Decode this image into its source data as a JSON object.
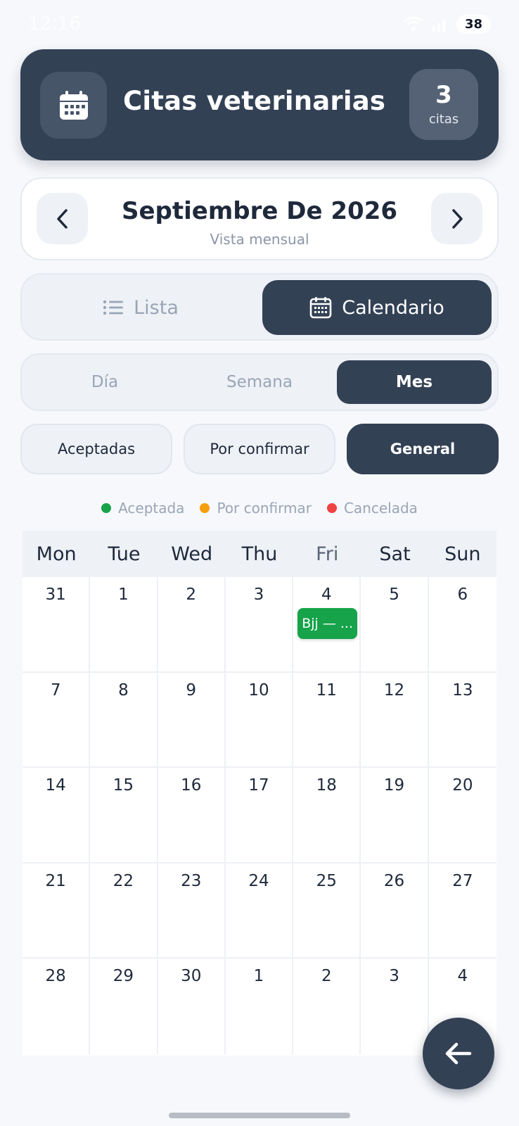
{
  "status_bar": {
    "time": "12:16",
    "battery": "38"
  },
  "header": {
    "title": "Citas veterinarias",
    "count": "3",
    "count_label": "citas",
    "icon": "calendar-icon"
  },
  "month_nav": {
    "title": "Septiembre De 2026",
    "subtitle": "Vista mensual"
  },
  "view_toggle": {
    "list_label": "Lista",
    "calendar_label": "Calendario",
    "selected": "Calendario"
  },
  "period_toggle": {
    "day": "Día",
    "week": "Semana",
    "month": "Mes",
    "selected": "Mes"
  },
  "filters": {
    "accepted": "Aceptadas",
    "pending": "Por confirmar",
    "general": "General",
    "selected": "General"
  },
  "legend": [
    {
      "label": "Aceptada",
      "color": "#16a34a"
    },
    {
      "label": "Por confirmar",
      "color": "#f59e0b"
    },
    {
      "label": "Cancelada",
      "color": "#ef4444"
    }
  ],
  "calendar": {
    "weekdays": [
      "Mon",
      "Tue",
      "Wed",
      "Thu",
      "Fri",
      "Sat",
      "Sun"
    ],
    "weeks": [
      [
        "31",
        "1",
        "2",
        "3",
        "4",
        "5",
        "6"
      ],
      [
        "7",
        "8",
        "9",
        "10",
        "11",
        "12",
        "13"
      ],
      [
        "14",
        "15",
        "16",
        "17",
        "18",
        "19",
        "20"
      ],
      [
        "21",
        "22",
        "23",
        "24",
        "25",
        "26",
        "27"
      ],
      [
        "28",
        "29",
        "30",
        "1",
        "2",
        "3",
        "4"
      ]
    ],
    "events": [
      {
        "week": 0,
        "day": 4,
        "label": "Bjj — ...",
        "status": "Aceptada",
        "color": "#16a34a"
      }
    ]
  },
  "colors": {
    "primary": "#334155",
    "background": "#f6f8fb",
    "accepted": "#16a34a",
    "pending": "#f59e0b",
    "cancelled": "#ef4444"
  }
}
